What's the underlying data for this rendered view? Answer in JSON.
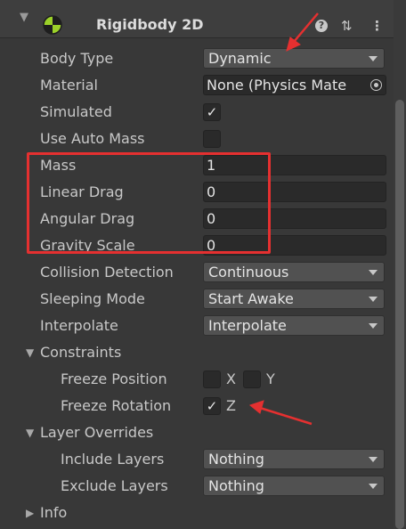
{
  "component": {
    "title": "Rigidbody 2D"
  },
  "fields": {
    "body_type": {
      "label": "Body Type",
      "value": "Dynamic"
    },
    "material": {
      "label": "Material",
      "value": "None (Physics Mate"
    },
    "simulated": {
      "label": "Simulated",
      "checked": true
    },
    "use_auto_mass": {
      "label": "Use Auto Mass",
      "checked": false
    },
    "mass": {
      "label": "Mass",
      "value": "1"
    },
    "linear_drag": {
      "label": "Linear Drag",
      "value": "0"
    },
    "angular_drag": {
      "label": "Angular Drag",
      "value": "0"
    },
    "gravity_scale": {
      "label": "Gravity Scale",
      "value": "0"
    },
    "collision_detection": {
      "label": "Collision Detection",
      "value": "Continuous"
    },
    "sleeping_mode": {
      "label": "Sleeping Mode",
      "value": "Start Awake"
    },
    "interpolate": {
      "label": "Interpolate",
      "value": "Interpolate"
    }
  },
  "constraints": {
    "label": "Constraints",
    "freeze_position": {
      "label": "Freeze Position",
      "x_label": "X",
      "y_label": "Y",
      "x": false,
      "y": false
    },
    "freeze_rotation": {
      "label": "Freeze Rotation",
      "z_label": "Z",
      "z": true
    }
  },
  "layer_overrides": {
    "label": "Layer Overrides",
    "include_layers": {
      "label": "Include Layers",
      "value": "Nothing"
    },
    "exclude_layers": {
      "label": "Exclude Layers",
      "value": "Nothing"
    }
  },
  "info": {
    "label": "Info"
  },
  "glyphs": {
    "check": "✓",
    "fold_open": "▼",
    "fold_closed": "▶",
    "help": "?",
    "presets": "⇅",
    "menu": "⋮"
  },
  "annotation_color": "#e53030"
}
